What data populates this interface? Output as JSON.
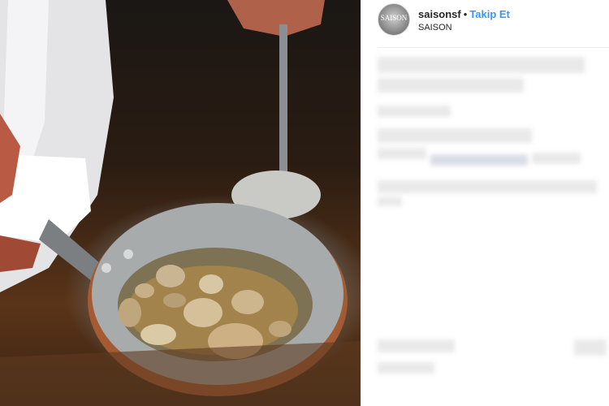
{
  "post": {
    "photo_alt": "copper pan with sliced mushrooms in broth"
  },
  "header": {
    "avatar_text": "SAISON",
    "username": "saisonsf",
    "separator": "•",
    "follow_label": "Takip Et",
    "location": "SAISON"
  },
  "colors": {
    "follow_accent": "#3897f0",
    "text": "#262626",
    "divider": "#efefef"
  }
}
